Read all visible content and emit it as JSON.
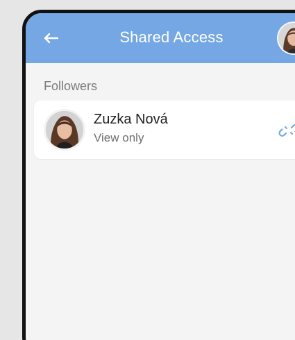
{
  "appbar": {
    "title": "Shared Access",
    "back_icon": "arrow-left-icon",
    "avatar": "user-avatar"
  },
  "followers": {
    "section_label": "Followers",
    "items": [
      {
        "name": "Zuzka Nová",
        "role": "View only",
        "action_icon": "unlink-icon"
      }
    ]
  },
  "colors": {
    "appbar_bg": "#74a7e3",
    "background": "#f4f4f4",
    "accent": "#74a7e3"
  }
}
